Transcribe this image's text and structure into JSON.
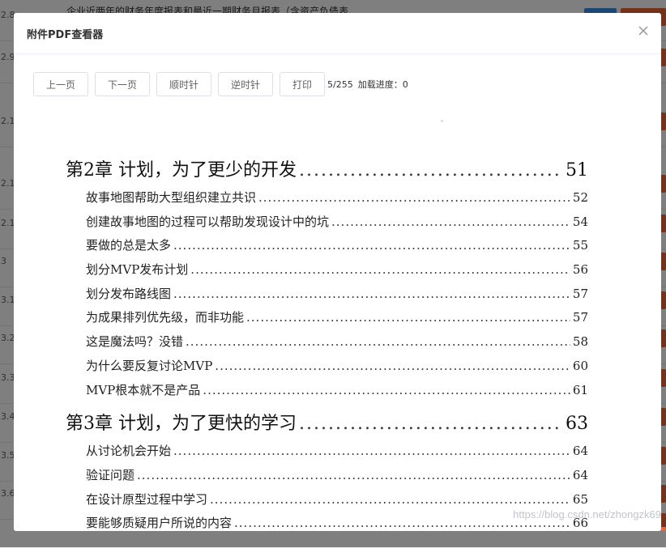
{
  "background": {
    "title_text": "企业近两年的财务年度报表和最近一期财务月报表（含资产负债表",
    "row_numbers": [
      "2.8",
      "2.9",
      "2.1",
      "2.1",
      "2.1",
      "3",
      "3.1",
      "3.2",
      "3.3",
      "3.4",
      "3.5",
      "3.6",
      ""
    ]
  },
  "modal": {
    "title": "附件PDF查看器",
    "close_label": "×"
  },
  "toolbar": {
    "prev_label": "上一页",
    "next_label": "下一页",
    "clockwise_label": "顺时针",
    "counterclockwise_label": "逆时针",
    "print_label": "打印",
    "page_indicator": "5/255",
    "load_progress": "加载进度：0"
  },
  "pdf": {
    "chapters": [
      {
        "title": "第2章 计划，为了更少的开发",
        "page": "51",
        "entries": [
          {
            "title": "故事地图帮助大型组织建立共识",
            "page": "52"
          },
          {
            "title": "创建故事地图的过程可以帮助发现设计中的坑",
            "page": "54"
          },
          {
            "title": "要做的总是太多",
            "page": "55"
          },
          {
            "title": "划分MVP发布计划",
            "page": "56"
          },
          {
            "title": "划分发布路线图",
            "page": "57"
          },
          {
            "title": "为成果排列优先级，而非功能",
            "page": "57"
          },
          {
            "title": "这是魔法吗？没错",
            "page": "58"
          },
          {
            "title": "为什么要反复讨论MVP",
            "page": "60"
          },
          {
            "title": "MVP根本就不是产品",
            "page": "61"
          }
        ]
      },
      {
        "title": "第3章 计划，为了更快的学习",
        "page": "63",
        "entries": [
          {
            "title": "从讨论机会开始",
            "page": "64"
          },
          {
            "title": "验证问题",
            "page": "64"
          },
          {
            "title": "在设计原型过程中学习",
            "page": "65"
          },
          {
            "title": "要能够质疑用户所说的内容",
            "page": "66"
          }
        ]
      }
    ],
    "watermark": "https://blog.csdn.net/zhongzk69"
  }
}
